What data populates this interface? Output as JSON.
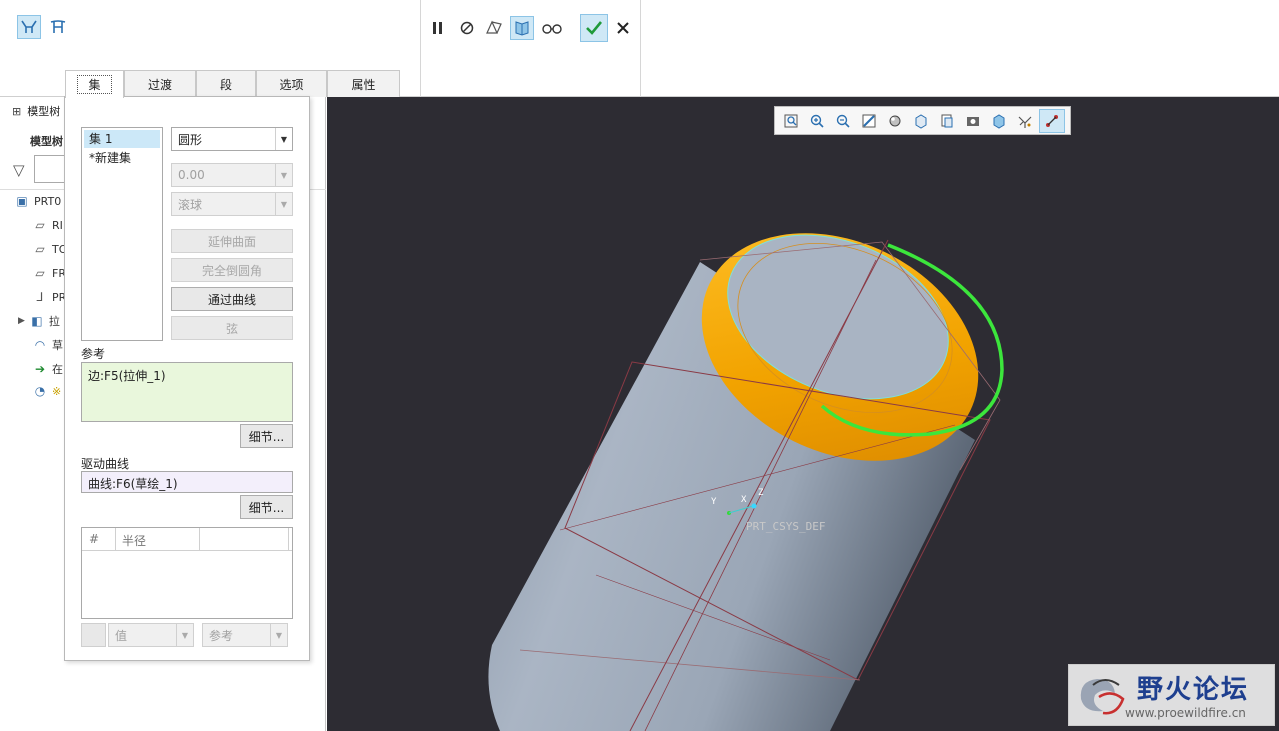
{
  "ribbon": {
    "left_icons": [
      "chain-icon",
      "tangent-chain-icon"
    ],
    "controls": [
      "pause-icon",
      "no-preview-icon",
      "preview-icon",
      "verify-mode-icon",
      "glasses-icon"
    ]
  },
  "tabs": [
    "集",
    "过渡",
    "段",
    "选项",
    "属性"
  ],
  "tree": {
    "header": "模型树",
    "subheader": "模型树",
    "items": [
      "PRT0",
      "RI",
      "TO",
      "FR",
      "PR",
      "拉",
      "草",
      "在",
      "※"
    ]
  },
  "panel": {
    "sets": [
      "集 1",
      "*新建集"
    ],
    "shape": "圆形",
    "value": "0.00",
    "ball": "滚球",
    "buttons": {
      "extend": "延伸曲面",
      "full_round": "完全倒圆角",
      "through_curve": "通过曲线",
      "chord": "弦"
    },
    "ref_label": "参考",
    "ref_value": "边:F5(拉伸_1)",
    "details": "细节...",
    "driving_label": "驱动曲线",
    "driving_value": "曲线:F6(草绘_1)",
    "table_headers": [
      "#",
      "半径"
    ],
    "value_combo": "值",
    "ref_combo": "参考"
  },
  "csys": {
    "name": "PRT_CSYS_DEF",
    "x": "X",
    "y": "Y",
    "z": "Z"
  },
  "watermark": {
    "title": "野火论坛",
    "url": "www.proewildfire.cn"
  },
  "colors": {
    "selected_blue": "#cfe8f6",
    "viewport_bg": "#2d2c33",
    "round_orange": "#f0a000",
    "curve_green": "#3ce63c",
    "reference_bg": "#e9f7dc",
    "driving_bg": "#f3effb"
  }
}
